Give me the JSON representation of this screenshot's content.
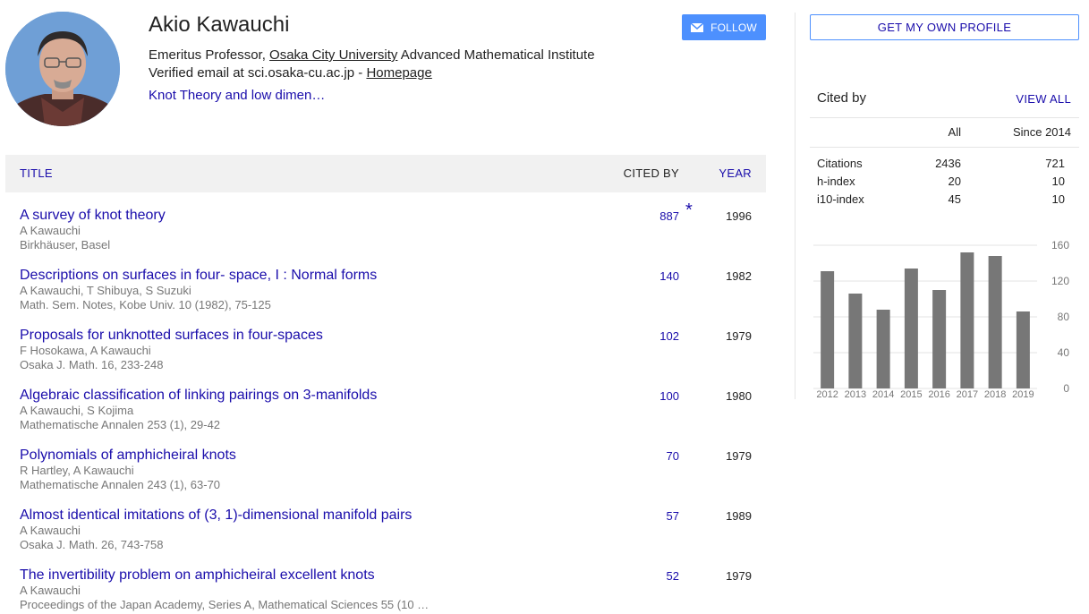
{
  "profile": {
    "name": "Akio Kawauchi",
    "affiliation_prefix": "Emeritus Professor, ",
    "affiliation_link": "Osaka City University",
    "affiliation_suffix": " Advanced Mathematical Institute",
    "email_text": "Verified email at sci.osaka-cu.ac.jp - ",
    "homepage_label": "Homepage",
    "interest": "Knot Theory and low dimen…",
    "follow_label": "FOLLOW"
  },
  "table": {
    "header_title": "TITLE",
    "header_cited": "CITED BY",
    "header_year": "YEAR",
    "rows": [
      {
        "title": "A survey of knot theory",
        "authors": "A Kawauchi",
        "venue": "Birkhäuser, Basel",
        "cited": "887",
        "star": "*",
        "year": "1996"
      },
      {
        "title": "Descriptions on surfaces in four- space, I : Normal forms",
        "authors": "A Kawauchi, T Shibuya, S Suzuki",
        "venue": "Math. Sem. Notes, Kobe Univ. 10 (1982), 75-125",
        "cited": "140",
        "star": "",
        "year": "1982"
      },
      {
        "title": "Proposals for unknotted surfaces in four-spaces",
        "authors": "F Hosokawa, A Kawauchi",
        "venue": "Osaka J. Math. 16, 233-248",
        "cited": "102",
        "star": "",
        "year": "1979"
      },
      {
        "title": "Algebraic classification of linking pairings on 3-manifolds",
        "authors": "A Kawauchi, S Kojima",
        "venue": "Mathematische Annalen 253 (1), 29-42",
        "cited": "100",
        "star": "",
        "year": "1980"
      },
      {
        "title": "Polynomials of amphicheiral knots",
        "authors": "R Hartley, A Kawauchi",
        "venue": "Mathematische Annalen 243 (1), 63-70",
        "cited": "70",
        "star": "",
        "year": "1979"
      },
      {
        "title": "Almost identical imitations of (3, 1)-dimensional manifold pairs",
        "authors": "A Kawauchi",
        "venue": "Osaka J. Math. 26, 743-758",
        "cited": "57",
        "star": "",
        "year": "1989"
      },
      {
        "title": "The invertibility problem on amphicheiral excellent knots",
        "authors": "A Kawauchi",
        "venue": "Proceedings of the Japan Academy, Series A, Mathematical Sciences 55 (10 …",
        "cited": "52",
        "star": "",
        "year": "1979"
      }
    ]
  },
  "sidebar": {
    "own_profile_label": "GET MY OWN PROFILE",
    "cited_by_label": "Cited by",
    "view_all_label": "VIEW ALL",
    "col_all": "All",
    "col_since": "Since 2014",
    "stats": [
      {
        "label": "Citations",
        "all": "2436",
        "since": "721"
      },
      {
        "label": "h-index",
        "all": "20",
        "since": "10"
      },
      {
        "label": "i10-index",
        "all": "45",
        "since": "10"
      }
    ]
  },
  "colors": {
    "link": "#1a0dab",
    "button": "#4d90fe",
    "bar": "#777777"
  },
  "chart_data": {
    "type": "bar",
    "categories": [
      "2012",
      "2013",
      "2014",
      "2015",
      "2016",
      "2017",
      "2018",
      "2019"
    ],
    "values": [
      131,
      106,
      88,
      134,
      110,
      152,
      148,
      86
    ],
    "yticks": [
      0,
      40,
      80,
      120,
      160
    ],
    "ylim": [
      0,
      160
    ],
    "axis_side": "right"
  }
}
